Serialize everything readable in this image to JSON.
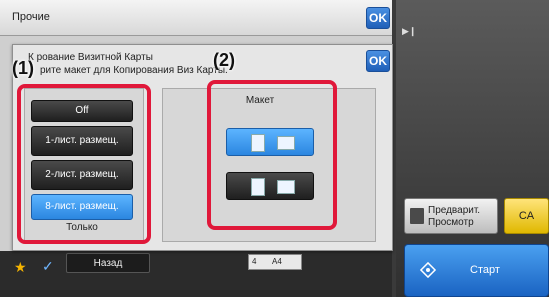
{
  "background": {
    "title": "Прочие",
    "ok": "OK"
  },
  "dialog": {
    "line1": "К    рование Визитной Карты",
    "line2": "рите макет для Копирования Виз          Карты.",
    "ok": "OK"
  },
  "options": {
    "items": [
      {
        "label": "Off",
        "selected": false
      },
      {
        "label": "1-лист. размещ.",
        "selected": false
      },
      {
        "label": "2-лист. размещ.",
        "selected": false
      },
      {
        "label": "8-лист. размещ.",
        "selected": true
      }
    ],
    "only_label": "Только"
  },
  "layout": {
    "title": "Макет"
  },
  "callouts": {
    "one": "(1)",
    "two": "(2)"
  },
  "right_panel": {
    "preview_label": "Предварит. Просмотр",
    "ca_label": "CA",
    "start_label": "Старт"
  },
  "bottom": {
    "back_label": "Назад",
    "tray_number": "4",
    "tray_size": "A4"
  },
  "colors": {
    "selected_blue": "#2b86e0",
    "ok_blue": "#1f5fb8",
    "callout_red": "#e0183a",
    "ca_yellow": "#e0b800"
  },
  "icons": [
    "star-icon",
    "check-icon",
    "play-icon",
    "preview-icon",
    "start-icon"
  ]
}
